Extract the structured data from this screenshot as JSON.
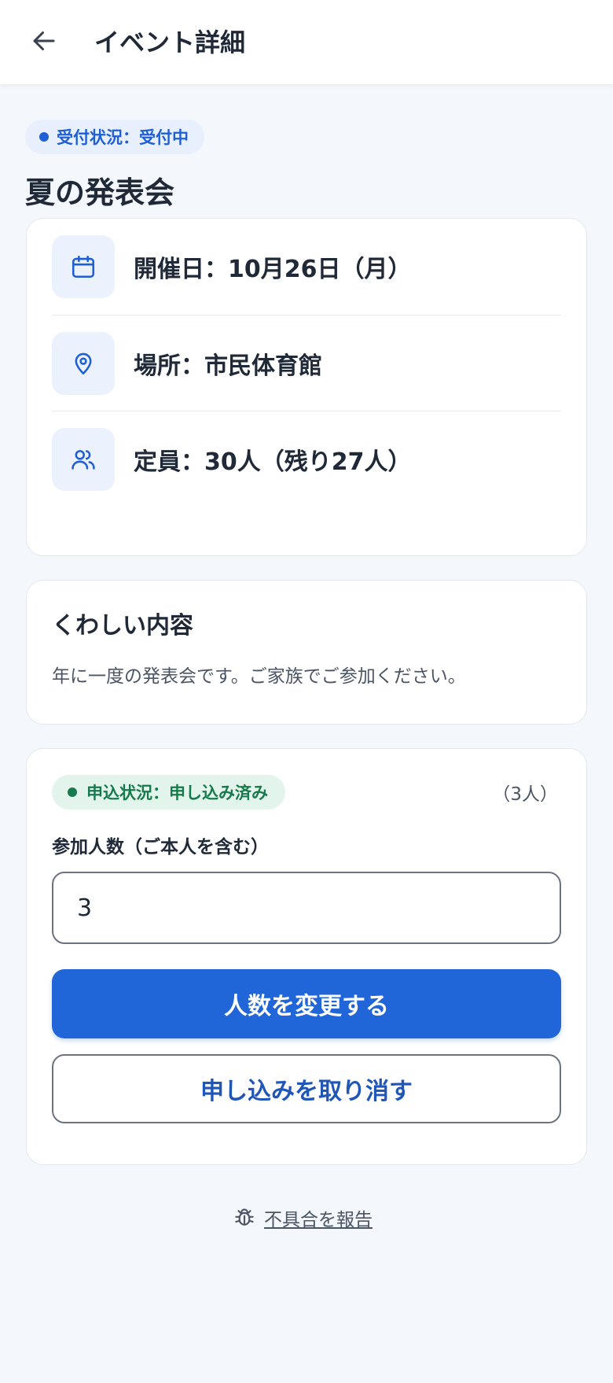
{
  "header": {
    "title": "イベント詳細",
    "back_icon": "arrow-left-icon"
  },
  "status": {
    "label": "受付状況：受付中",
    "color": "#1f5fd6"
  },
  "event": {
    "title": "夏の発表会"
  },
  "info": {
    "date": {
      "icon": "calendar-icon",
      "text": "開催日：10月26日（月）"
    },
    "place": {
      "icon": "location-pin-icon",
      "text": "場所：市民体育館"
    },
    "capacity": {
      "icon": "users-icon",
      "text": "定員：30人（残り27人）"
    }
  },
  "details": {
    "heading": "くわしい内容",
    "body": "年に一度の発表会です。ご家族でご参加ください。"
  },
  "application": {
    "status_label": "申込状況：申し込み済み",
    "status_color": "#177a4a",
    "count_note": "（3人）",
    "field_label": "参加人数（ご本人を含む）",
    "count_value": "3",
    "change_button": "人数を変更する",
    "cancel_button": "申し込みを取り消す"
  },
  "footer": {
    "report_icon": "bug-icon",
    "report_link": "不具合を報告"
  },
  "colors": {
    "accent": "#2166d8",
    "background": "#f4f7fb"
  }
}
